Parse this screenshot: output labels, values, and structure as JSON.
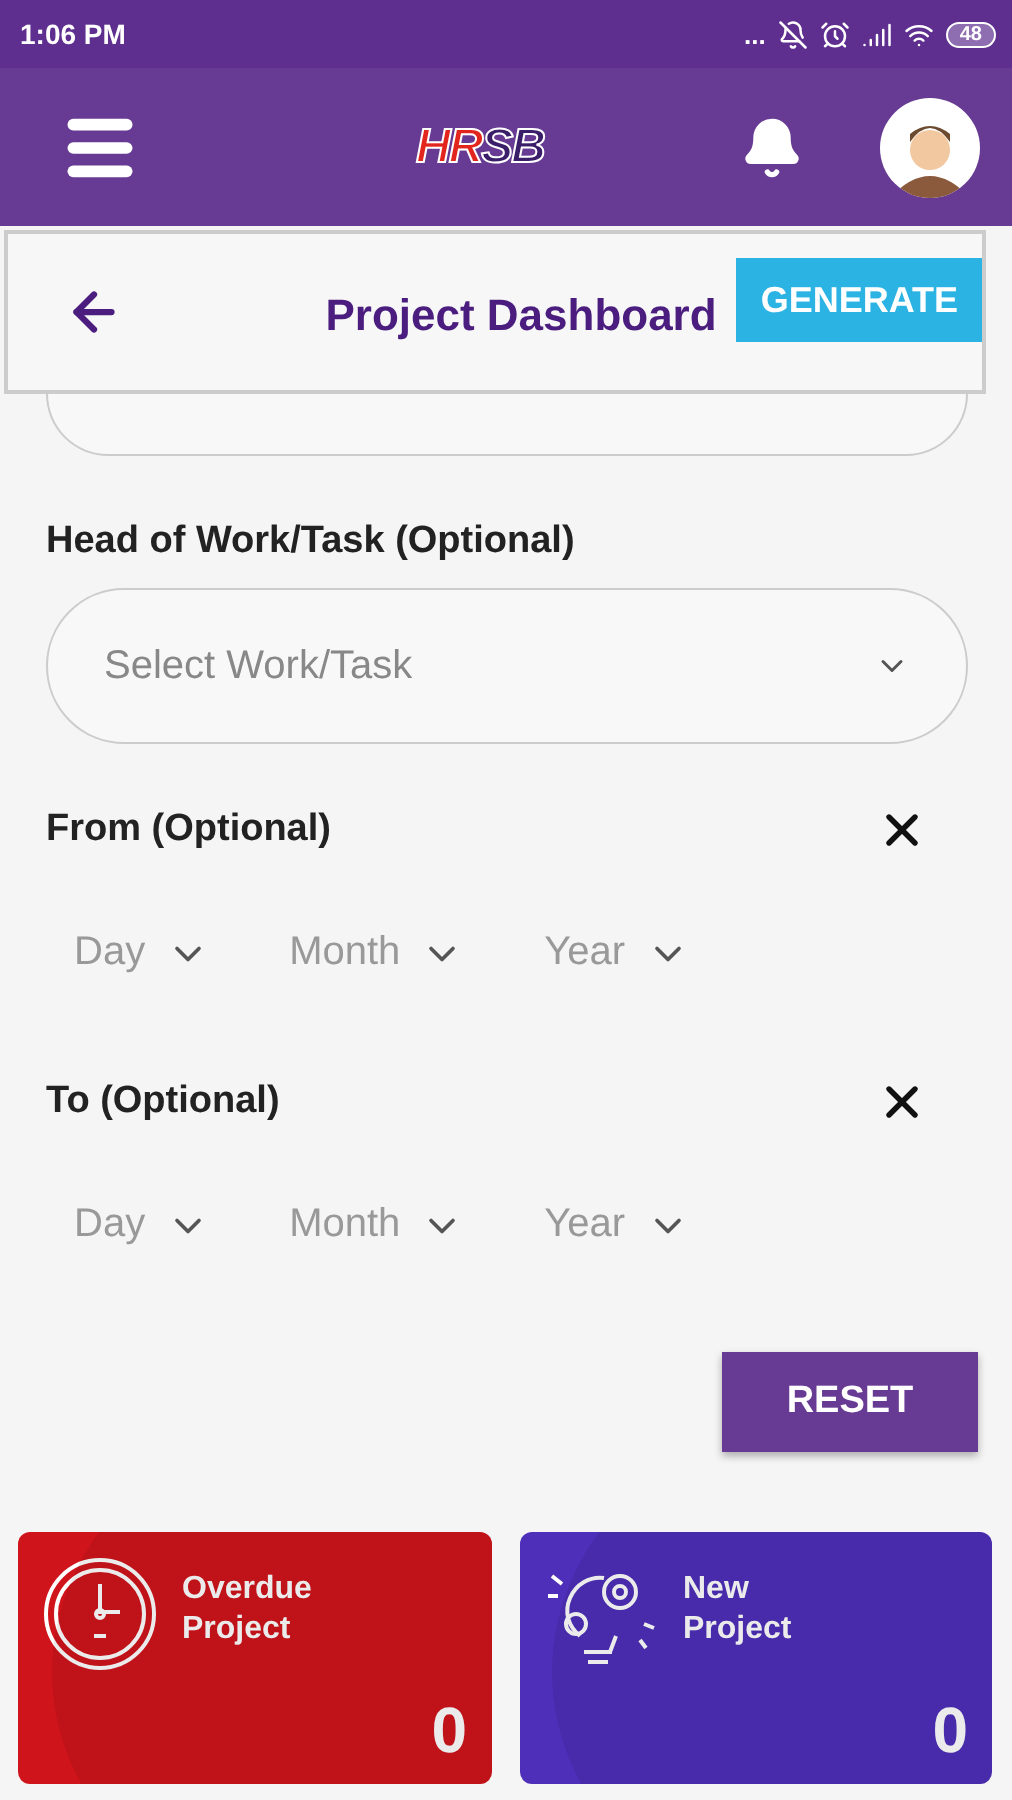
{
  "status_bar": {
    "time": "1:06 PM",
    "dots": "...",
    "battery": "48"
  },
  "app_bar": {
    "logo": {
      "first": "HR",
      "rest": "SB"
    }
  },
  "header": {
    "title": "Project Dashboard",
    "generate_button": "GENERATE"
  },
  "form": {
    "head_of_work": {
      "label": "Head of Work/Task (Optional)",
      "placeholder": "Select Work/Task"
    },
    "ranges": [
      {
        "label": "From (Optional)",
        "day": "Day",
        "month": "Month",
        "year": "Year"
      },
      {
        "label": "To (Optional)",
        "day": "Day",
        "month": "Month",
        "year": "Year"
      }
    ],
    "reset_button": "RESET"
  },
  "cards": [
    {
      "kind": "clock",
      "title": "Overdue Project",
      "count": "0",
      "color": "#d0141c"
    },
    {
      "kind": "idea",
      "title": "New Project",
      "count": "0",
      "color": "#4e2fba"
    }
  ]
}
